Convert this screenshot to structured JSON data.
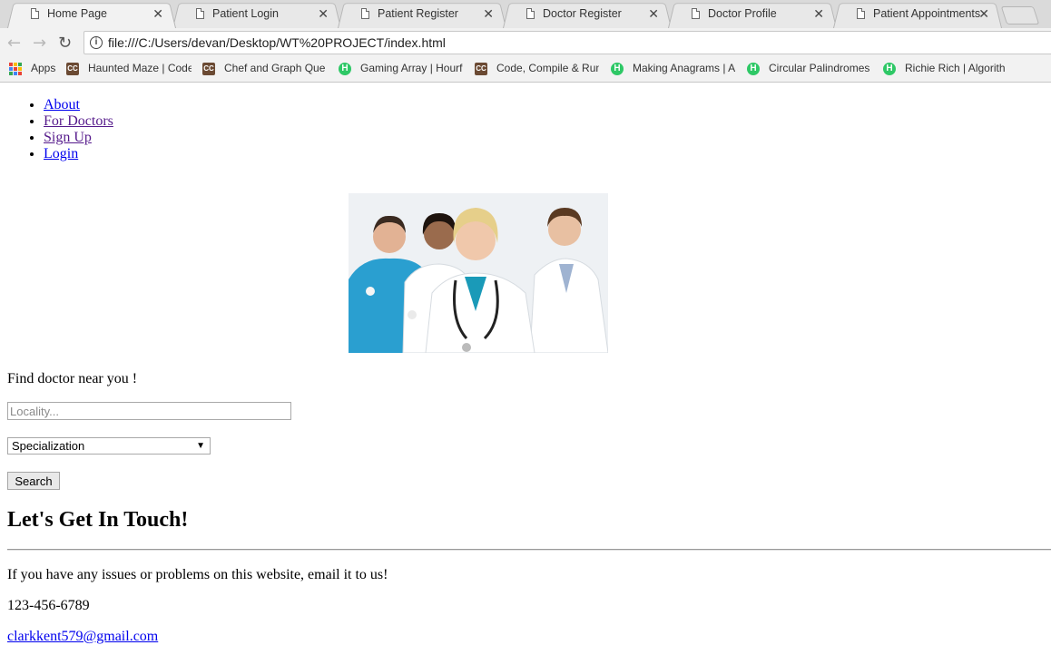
{
  "browser": {
    "tabs": [
      {
        "label": "Home Page",
        "active": true
      },
      {
        "label": "Patient Login",
        "active": false
      },
      {
        "label": "Patient Register",
        "active": false
      },
      {
        "label": "Doctor Register",
        "active": false
      },
      {
        "label": "Doctor Profile",
        "active": false
      },
      {
        "label": "Patient Appointments",
        "active": false
      }
    ],
    "close_glyph": "✕",
    "url": "file:///C:/Users/devan/Desktop/WT%20PROJECT/index.html",
    "bookmarks": [
      {
        "label": "Apps",
        "icon": "apps-grid-icon"
      },
      {
        "label": "Haunted Maze | Code",
        "icon": "codechef-icon"
      },
      {
        "label": "Chef and Graph Quer",
        "icon": "codechef-icon"
      },
      {
        "label": "Gaming Array | Hourf",
        "icon": "hackerearth-icon"
      },
      {
        "label": "Code, Compile & Run",
        "icon": "codechef-icon"
      },
      {
        "label": "Making Anagrams | A",
        "icon": "hackerearth-icon"
      },
      {
        "label": "Circular Palindromes",
        "icon": "hackerearth-icon"
      },
      {
        "label": "Richie Rich | Algorith",
        "icon": "hackerearth-icon"
      }
    ]
  },
  "nav": {
    "about": "About",
    "for_doctors": "For Doctors",
    "sign_up": "Sign Up",
    "login": "Login"
  },
  "search": {
    "heading": "Find doctor near you !",
    "locality_placeholder": "Locality...",
    "specialization_value": "Specialization",
    "button": "Search"
  },
  "contact": {
    "heading": "Let's Get In Touch!",
    "text": "If you have any issues or problems on this website, email it to us!",
    "phone": "123-456-6789",
    "email": "clarkkent579@gmail.com"
  }
}
